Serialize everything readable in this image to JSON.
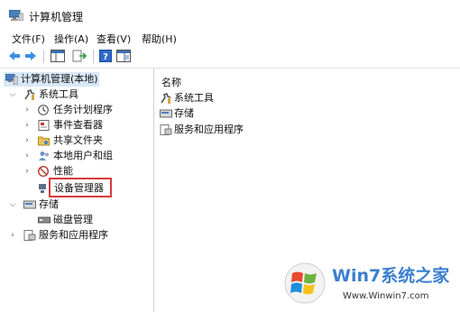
{
  "window": {
    "title": "计算机管理"
  },
  "menu": [
    "文件(F)",
    "操作(A)",
    "查看(V)",
    "帮助(H)"
  ],
  "toolbar": {
    "buttons": [
      "back-icon",
      "forward-icon",
      "show-hide-tree-icon",
      "export-list-icon",
      "help-icon",
      "properties-icon"
    ]
  },
  "tree": {
    "root": "计算机管理(本地)",
    "system_tools": "系统工具",
    "task_scheduler": "任务计划程序",
    "event_viewer": "事件查看器",
    "shared_folders": "共享文件夹",
    "local_users": "本地用户和组",
    "performance": "性能",
    "device_manager": "设备管理器",
    "storage": "存储",
    "disk_management": "磁盘管理",
    "services_apps": "服务和应用程序"
  },
  "list": {
    "header": "名称",
    "items": [
      "系统工具",
      "存储",
      "服务和应用程序"
    ]
  },
  "watermark": {
    "brand": "Win7系统之家",
    "url": "Www.Winwin7.com"
  },
  "colors": {
    "selection": "#d9e8f7",
    "highlight_border": "#d93a3a",
    "watermark_blue": "#3b7fcf"
  }
}
